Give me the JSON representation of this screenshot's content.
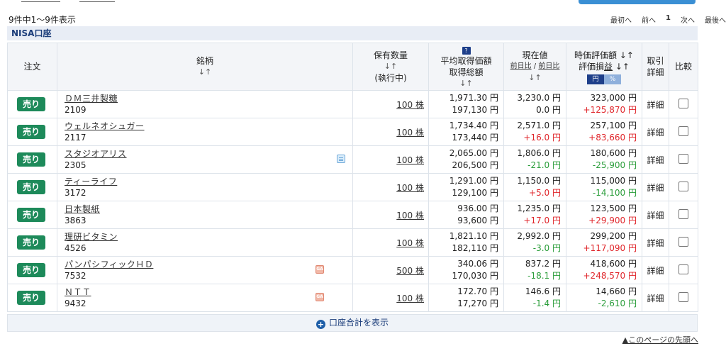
{
  "summary": "9件中1〜9件表示",
  "pager": {
    "first": "最初へ",
    "prev": "前へ",
    "current": "1",
    "next": "次へ",
    "last": "最後へ"
  },
  "section_title": "NISA口座",
  "headers": {
    "order": "注文",
    "name": "銘柄",
    "name_sort": "↓↑",
    "qty": "保有数量",
    "qty_sort": "↓↑",
    "qty_sub": "(執行中)",
    "avg_icon": "?",
    "avg": "平均取得価額",
    "total_cost": "取得総額",
    "avg_sort": "↓↑",
    "price": "現在値",
    "price_sub_1": "前日比",
    "price_sub_sep": " / ",
    "price_sub_2": "前日比",
    "price_sort": "↓↑",
    "mv": "時価評価額 ↓↑",
    "pl_a": "評価損",
    "pl_b": "益",
    "pl_sort": " ↓↑",
    "ccy_yen": "円",
    "ccy_pct": "%",
    "trade_1": "取引",
    "trade_2": "詳細",
    "compare": "比較"
  },
  "sell_label": "売り",
  "detail_label": "詳細",
  "rows": [
    {
      "name": "ＤＭ三井製糖",
      "code": "2109",
      "qty": "100 株",
      "avg": "1,971.30 円",
      "cost": "197,130 円",
      "price": "3,230.0 円",
      "chg": "0.0 円",
      "chg_sign": "zero",
      "mv": "323,000 円",
      "pl": "+125,870 円",
      "pl_sign": "pos",
      "icon": ""
    },
    {
      "name": "ウェルネオシュガー",
      "code": "2117",
      "qty": "100 株",
      "avg": "1,734.40 円",
      "cost": "173,440 円",
      "price": "2,571.0 円",
      "chg": "+16.0 円",
      "chg_sign": "pos",
      "mv": "257,100 円",
      "pl": "+83,660 円",
      "pl_sign": "pos",
      "icon": ""
    },
    {
      "name": "スタジオアリス",
      "code": "2305",
      "qty": "100 株",
      "avg": "2,065.00 円",
      "cost": "206,500 円",
      "price": "1,806.0 円",
      "chg": "-21.0 円",
      "chg_sign": "neg",
      "mv": "180,600 円",
      "pl": "-25,900 円",
      "pl_sign": "neg",
      "icon": "cal"
    },
    {
      "name": "ティーライフ",
      "code": "3172",
      "qty": "100 株",
      "avg": "1,291.00 円",
      "cost": "129,100 円",
      "price": "1,150.0 円",
      "chg": "+5.0 円",
      "chg_sign": "pos",
      "mv": "115,000 円",
      "pl": "-14,100 円",
      "pl_sign": "neg",
      "icon": ""
    },
    {
      "name": "日本製紙",
      "code": "3863",
      "qty": "100 株",
      "avg": "936.00 円",
      "cost": "93,600 円",
      "price": "1,235.0 円",
      "chg": "+17.0 円",
      "chg_sign": "pos",
      "mv": "123,500 円",
      "pl": "+29,900 円",
      "pl_sign": "pos",
      "icon": ""
    },
    {
      "name": "理研ビタミン",
      "code": "4526",
      "qty": "100 株",
      "avg": "1,821.10 円",
      "cost": "182,110 円",
      "price": "2,992.0 円",
      "chg": "-3.0 円",
      "chg_sign": "neg",
      "mv": "299,200 円",
      "pl": "+117,090 円",
      "pl_sign": "pos",
      "icon": ""
    },
    {
      "name": "パンパシフィックＨＤ",
      "code": "7532",
      "qty": "500 株",
      "avg": "340.06 円",
      "cost": "170,030 円",
      "price": "837.2 円",
      "chg": "-18.1 円",
      "chg_sign": "neg",
      "mv": "418,600 円",
      "pl": "+248,570 円",
      "pl_sign": "pos",
      "icon": "ga"
    },
    {
      "name": "ＮＴＴ",
      "code": "9432",
      "qty": "100 株",
      "avg": "172.70 円",
      "cost": "17,270 円",
      "price": "146.6 円",
      "chg": "-1.4 円",
      "chg_sign": "neg",
      "mv": "14,660 円",
      "pl": "-2,610 円",
      "pl_sign": "neg",
      "icon": "ga"
    }
  ],
  "ga_label": "GA",
  "total_label": "口座合計を表示",
  "page_top": "▲このページの先頭へ",
  "colors": {
    "sell_green": "#1d8a5a",
    "positive": "#e0262b",
    "negative": "#2a9d3a",
    "header_blue": "#1b3d7a"
  }
}
